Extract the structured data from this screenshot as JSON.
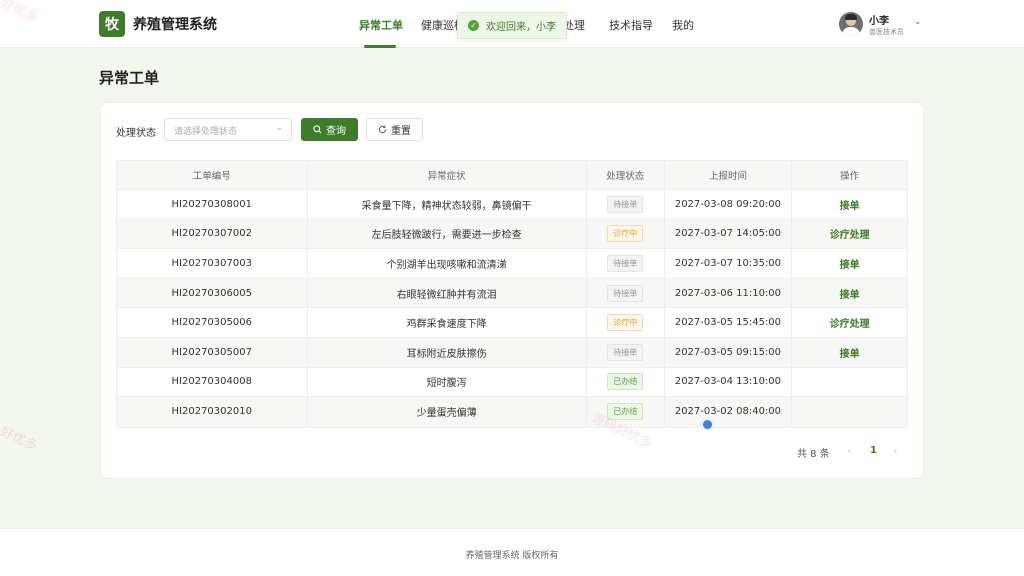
{
  "header": {
    "logo_char": "牧",
    "app_title": "养殖管理系统",
    "nav": [
      {
        "label": "异常工单",
        "active": true
      },
      {
        "label": "健康巡检",
        "active": false
      },
      {
        "label": "诊疗处理",
        "active": false
      },
      {
        "label": "技术指导",
        "active": false
      },
      {
        "label": "我的",
        "active": false
      }
    ],
    "toast": "欢迎回来，小李",
    "user_name": "小李",
    "user_role": "兽医技术员"
  },
  "page": {
    "title": "异常工单"
  },
  "filter": {
    "label": "处理状态",
    "placeholder": "请选择处理状态",
    "query_label": "查询",
    "reset_label": "重置"
  },
  "table": {
    "columns": [
      "工单编号",
      "异常症状",
      "处理状态",
      "上报时间",
      "操作"
    ],
    "rows": [
      {
        "id": "HI20270308001",
        "symptom": "采食量下降，精神状态较弱，鼻镜偏干",
        "status": "待接单",
        "time": "2027-03-08 09:20:00",
        "action": "接单"
      },
      {
        "id": "HI20270307002",
        "symptom": "左后肢轻微跛行，需要进一步检查",
        "status": "诊疗中",
        "time": "2027-03-07 14:05:00",
        "action": "诊疗处理"
      },
      {
        "id": "HI20270307003",
        "symptom": "个别湖羊出现咳嗽和流清涕",
        "status": "待接单",
        "time": "2027-03-07 10:35:00",
        "action": "接单"
      },
      {
        "id": "HI20270306005",
        "symptom": "右眼轻微红肿并有流泪",
        "status": "待接单",
        "time": "2027-03-06 11:10:00",
        "action": "接单"
      },
      {
        "id": "HI20270305006",
        "symptom": "鸡群采食速度下降",
        "status": "诊疗中",
        "time": "2027-03-05 15:45:00",
        "action": "诊疗处理"
      },
      {
        "id": "HI20270305007",
        "symptom": "耳标附近皮肤擦伤",
        "status": "待接单",
        "time": "2027-03-05 09:15:00",
        "action": "接单"
      },
      {
        "id": "HI20270304008",
        "symptom": "短时腹泻",
        "status": "已办结",
        "time": "2027-03-04 13:10:00",
        "action": ""
      },
      {
        "id": "HI20270302010",
        "symptom": "少量蛋壳偏薄",
        "status": "已办结",
        "time": "2027-03-02 08:40:00",
        "action": ""
      }
    ]
  },
  "pagination": {
    "total": "共 8 条",
    "current": "1"
  },
  "footer": {
    "text": "养殖管理系统 版权所有"
  },
  "watermarks": [
    "好优多",
    "好优多",
    "源码好优多"
  ],
  "colors": {
    "primary": "#3e7b2a",
    "pending": "#909399",
    "treating": "#e6a23c",
    "done": "#52a33a"
  }
}
